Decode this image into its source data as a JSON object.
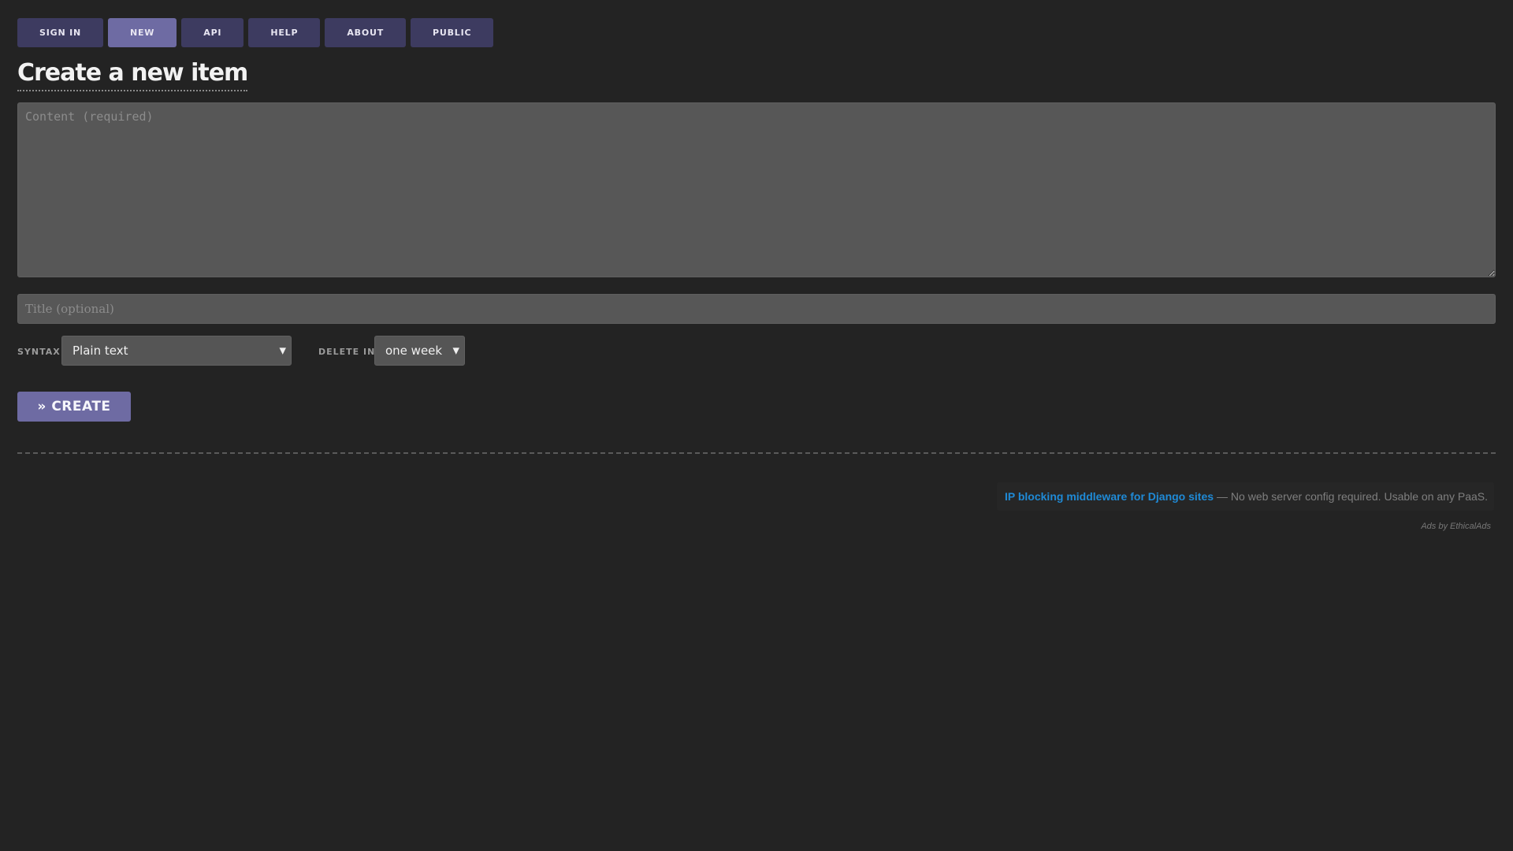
{
  "nav": {
    "items": [
      {
        "label": "SIGN IN"
      },
      {
        "label": "NEW"
      },
      {
        "label": "API"
      },
      {
        "label": "HELP"
      },
      {
        "label": "ABOUT"
      },
      {
        "label": "PUBLIC"
      }
    ],
    "active": "NEW"
  },
  "page": {
    "title": "Create a new item"
  },
  "form": {
    "content_placeholder": "Content (required)",
    "content_value": "",
    "title_placeholder": "Title (optional)",
    "title_value": "",
    "syntax_label": "SYNTAX",
    "syntax_value": "Plain text",
    "delete_label": "DELETE IN",
    "delete_value": "one week",
    "create_label": "» CREATE",
    "chevron_icon": "chevron-down-icon"
  },
  "ad": {
    "link_text": "IP blocking middleware for Django sites",
    "description": "— No web server config required. Usable on any PaaS.",
    "credit": "Ads by EthicalAds"
  },
  "colors": {
    "background": "#232323",
    "nav_button": "#3d3b60",
    "accent": "#6e6ba3",
    "input_bg": "#575757",
    "ad_link": "#1f8ad6"
  }
}
